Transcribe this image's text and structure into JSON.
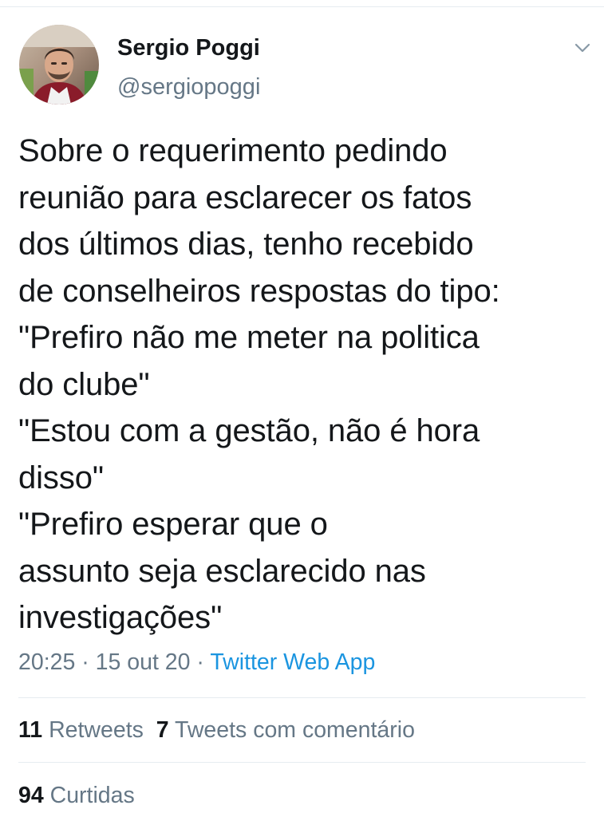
{
  "author": {
    "name": "Sergio Poggi",
    "handle": "@sergiopoggi"
  },
  "tweet": {
    "text": "Sobre o requerimento pedindo\nreunião para esclarecer os fatos\ndos últimos dias, tenho recebido\nde conselheiros respostas do tipo:\n\"Prefiro não me meter na politica\ndo clube\"\n\"Estou com a gestão, não é hora\ndisso\"\n\"Prefiro esperar que o\nassunto seja esclarecido nas\ninvestigações\"",
    "time": "20:25",
    "date": "15 out 20",
    "separator": " · ",
    "source": "Twitter Web App"
  },
  "stats": {
    "retweets_count": "11",
    "retweets_label": "Retweets",
    "quotes_count": "7",
    "quotes_label": "Tweets com comentário",
    "likes_count": "94",
    "likes_label": "Curtidas"
  },
  "icons": {
    "menu": "chevron-down-icon",
    "avatar": "profile-photo"
  },
  "colors": {
    "text": "#14171a",
    "secondary": "#657786",
    "link": "#1b95e0",
    "divider": "#e6ecf0"
  }
}
